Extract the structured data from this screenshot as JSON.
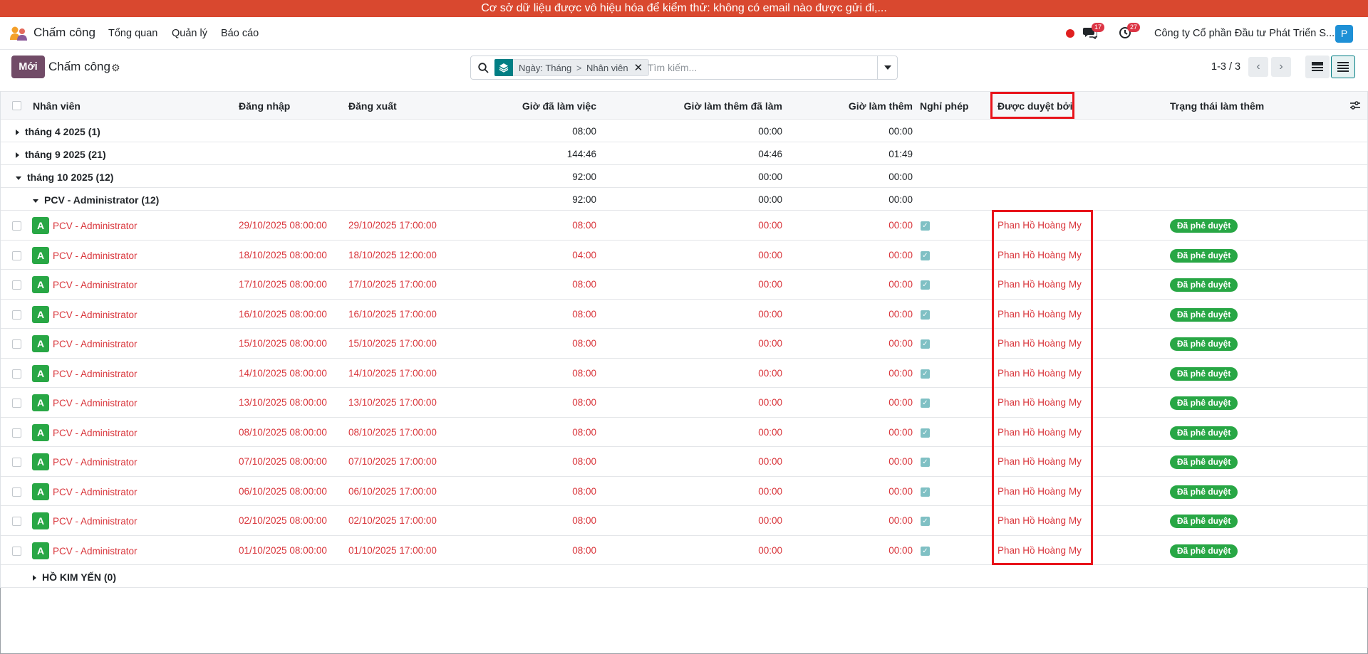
{
  "banner": "Cơ sở dữ liệu được vô hiệu hóa để kiểm thử: không có email nào được gửi đi,...",
  "navbar": {
    "app_name": "Chấm công",
    "menu": [
      "Tổng quan",
      "Quản lý",
      "Báo cáo"
    ],
    "messages_count": "17",
    "activities_count": "27",
    "company": "Công ty Cổ phần Đầu tư Phát Triển S...",
    "user_initial": "P"
  },
  "control": {
    "new_label": "Mới",
    "title": "Chấm công",
    "facet_first": "Ngày: Tháng",
    "facet_sep": ">",
    "facet_second": "Nhân viên",
    "search_placeholder": "Tìm kiếm...",
    "pager": "1-3 / 3"
  },
  "columns": {
    "employee": "Nhân viên",
    "check_in": "Đăng nhập",
    "check_out": "Đăng xuất",
    "worked_hours": "Giờ đã làm việc",
    "overtime_done": "Giờ làm thêm đã làm",
    "overtime": "Giờ làm thêm",
    "leave": "Nghỉ phép",
    "approved_by": "Được duyệt bởi",
    "overtime_status": "Trạng thái làm thêm"
  },
  "groups": [
    {
      "label": "tháng 4 2025 (1)",
      "worked": "08:00",
      "ot_done": "00:00",
      "ot": "00:00"
    },
    {
      "label": "tháng 9 2025 (21)",
      "worked": "144:46",
      "ot_done": "04:46",
      "ot": "01:49"
    },
    {
      "label": "tháng 10 2025 (12)",
      "worked": "92:00",
      "ot_done": "00:00",
      "ot": "00:00"
    }
  ],
  "subgroup": {
    "label": "PCV - Administrator (12)",
    "worked": "92:00",
    "ot_done": "00:00",
    "ot": "00:00"
  },
  "records": [
    {
      "avatar": "A",
      "employee": "PCV - Administrator",
      "check_in": "29/10/2025 08:00:00",
      "check_out": "29/10/2025 17:00:00",
      "worked": "08:00",
      "ot_done": "00:00",
      "ot": "00:00",
      "approved_by": "Phan Hồ Hoàng My",
      "status": "Đã phê duyệt"
    },
    {
      "avatar": "A",
      "employee": "PCV - Administrator",
      "check_in": "18/10/2025 08:00:00",
      "check_out": "18/10/2025 12:00:00",
      "worked": "04:00",
      "ot_done": "00:00",
      "ot": "00:00",
      "approved_by": "Phan Hồ Hoàng My",
      "status": "Đã phê duyệt"
    },
    {
      "avatar": "A",
      "employee": "PCV - Administrator",
      "check_in": "17/10/2025 08:00:00",
      "check_out": "17/10/2025 17:00:00",
      "worked": "08:00",
      "ot_done": "00:00",
      "ot": "00:00",
      "approved_by": "Phan Hồ Hoàng My",
      "status": "Đã phê duyệt"
    },
    {
      "avatar": "A",
      "employee": "PCV - Administrator",
      "check_in": "16/10/2025 08:00:00",
      "check_out": "16/10/2025 17:00:00",
      "worked": "08:00",
      "ot_done": "00:00",
      "ot": "00:00",
      "approved_by": "Phan Hồ Hoàng My",
      "status": "Đã phê duyệt"
    },
    {
      "avatar": "A",
      "employee": "PCV - Administrator",
      "check_in": "15/10/2025 08:00:00",
      "check_out": "15/10/2025 17:00:00",
      "worked": "08:00",
      "ot_done": "00:00",
      "ot": "00:00",
      "approved_by": "Phan Hồ Hoàng My",
      "status": "Đã phê duyệt"
    },
    {
      "avatar": "A",
      "employee": "PCV - Administrator",
      "check_in": "14/10/2025 08:00:00",
      "check_out": "14/10/2025 17:00:00",
      "worked": "08:00",
      "ot_done": "00:00",
      "ot": "00:00",
      "approved_by": "Phan Hồ Hoàng My",
      "status": "Đã phê duyệt"
    },
    {
      "avatar": "A",
      "employee": "PCV - Administrator",
      "check_in": "13/10/2025 08:00:00",
      "check_out": "13/10/2025 17:00:00",
      "worked": "08:00",
      "ot_done": "00:00",
      "ot": "00:00",
      "approved_by": "Phan Hồ Hoàng My",
      "status": "Đã phê duyệt"
    },
    {
      "avatar": "A",
      "employee": "PCV - Administrator",
      "check_in": "08/10/2025 08:00:00",
      "check_out": "08/10/2025 17:00:00",
      "worked": "08:00",
      "ot_done": "00:00",
      "ot": "00:00",
      "approved_by": "Phan Hồ Hoàng My",
      "status": "Đã phê duyệt"
    },
    {
      "avatar": "A",
      "employee": "PCV - Administrator",
      "check_in": "07/10/2025 08:00:00",
      "check_out": "07/10/2025 17:00:00",
      "worked": "08:00",
      "ot_done": "00:00",
      "ot": "00:00",
      "approved_by": "Phan Hồ Hoàng My",
      "status": "Đã phê duyệt"
    },
    {
      "avatar": "A",
      "employee": "PCV - Administrator",
      "check_in": "06/10/2025 08:00:00",
      "check_out": "06/10/2025 17:00:00",
      "worked": "08:00",
      "ot_done": "00:00",
      "ot": "00:00",
      "approved_by": "Phan Hồ Hoàng My",
      "status": "Đã phê duyệt"
    },
    {
      "avatar": "A",
      "employee": "PCV - Administrator",
      "check_in": "02/10/2025 08:00:00",
      "check_out": "02/10/2025 17:00:00",
      "worked": "08:00",
      "ot_done": "00:00",
      "ot": "00:00",
      "approved_by": "Phan Hồ Hoàng My",
      "status": "Đã phê duyệt"
    },
    {
      "avatar": "A",
      "employee": "PCV - Administrator",
      "check_in": "01/10/2025 08:00:00",
      "check_out": "01/10/2025 17:00:00",
      "worked": "08:00",
      "ot_done": "00:00",
      "ot": "00:00",
      "approved_by": "Phan Hồ Hoàng My",
      "status": "Đã phê duyệt"
    }
  ],
  "subgroup2": {
    "label": "HỒ KIM YẾN (0)"
  },
  "colors": {
    "banner": "#d9482f",
    "brand": "#714b67",
    "accent": "#017e84",
    "success": "#28a745",
    "danger": "#d9353b",
    "highlight": "#e8141b"
  }
}
